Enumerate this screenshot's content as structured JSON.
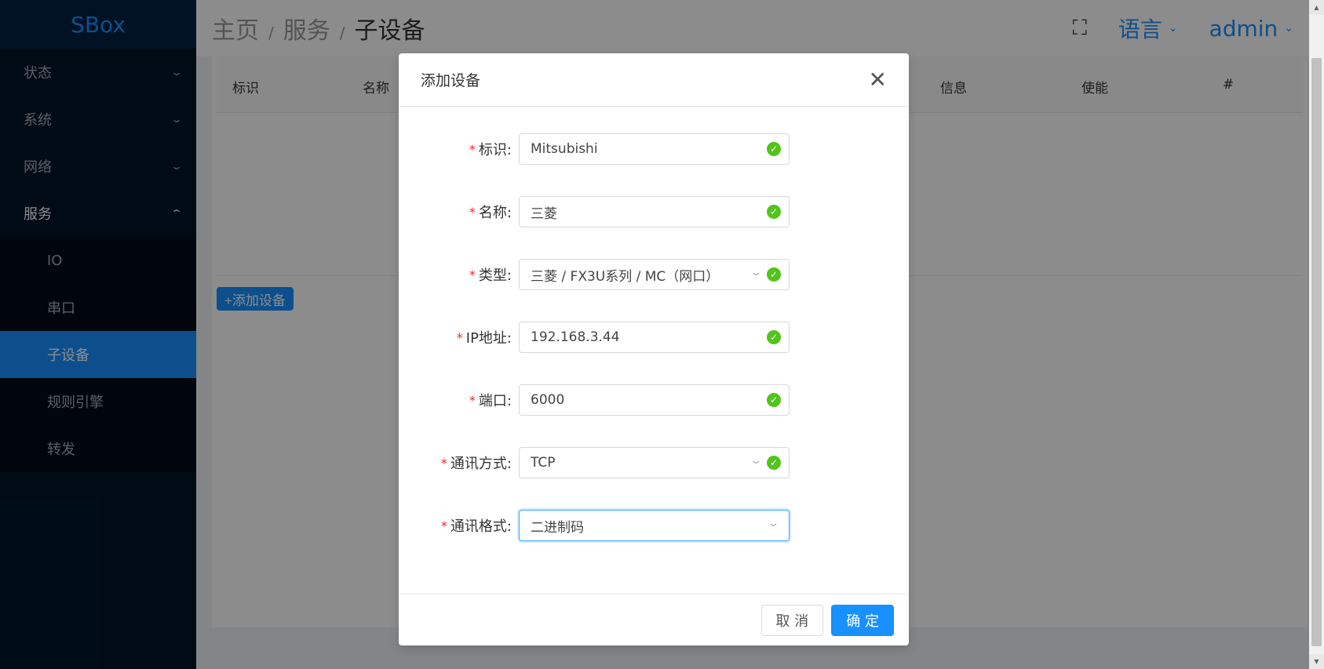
{
  "app": {
    "logo": "SBox"
  },
  "sidebar": {
    "items": [
      {
        "label": "状态",
        "chevron": "⌄"
      },
      {
        "label": "系统",
        "chevron": "⌄"
      },
      {
        "label": "网络",
        "chevron": "⌄"
      },
      {
        "label": "服务",
        "chevron": "⌃"
      }
    ],
    "subitems": [
      {
        "label": "IO"
      },
      {
        "label": "串口"
      },
      {
        "label": "子设备"
      },
      {
        "label": "规则引擎"
      },
      {
        "label": "转发"
      }
    ]
  },
  "header": {
    "breadcrumb": [
      "主页",
      "服务",
      "子设备"
    ],
    "separator": "/",
    "fullscreen_icon": "⛶",
    "language_label": "语言",
    "user_label": "admin",
    "arrow": "⌄"
  },
  "table": {
    "columns": [
      "标识",
      "名称",
      "信息",
      "使能",
      "#"
    ]
  },
  "add_device_button": "+添加设备",
  "modal": {
    "title": "添加设备",
    "close_icon": "✕",
    "fields": [
      {
        "label": "标识:",
        "value": "Mitsubishi"
      },
      {
        "label": "名称:",
        "value": "三菱"
      },
      {
        "label": "类型:",
        "value": "三菱 / FX3U系列 / MC（网口）"
      },
      {
        "label": "IP地址:",
        "value": "192.168.3.44"
      },
      {
        "label": "端口:",
        "value": "6000"
      },
      {
        "label": "通讯方式:",
        "value": "TCP"
      },
      {
        "label": "通讯格式:",
        "value": "二进制码"
      }
    ],
    "required_mark": "*",
    "check_icon": "✓",
    "dropdown_icon": "⌄",
    "cancel_label": "取 消",
    "ok_label": "确 定"
  },
  "scrollbar": {
    "up": "▲",
    "down": "▼"
  }
}
